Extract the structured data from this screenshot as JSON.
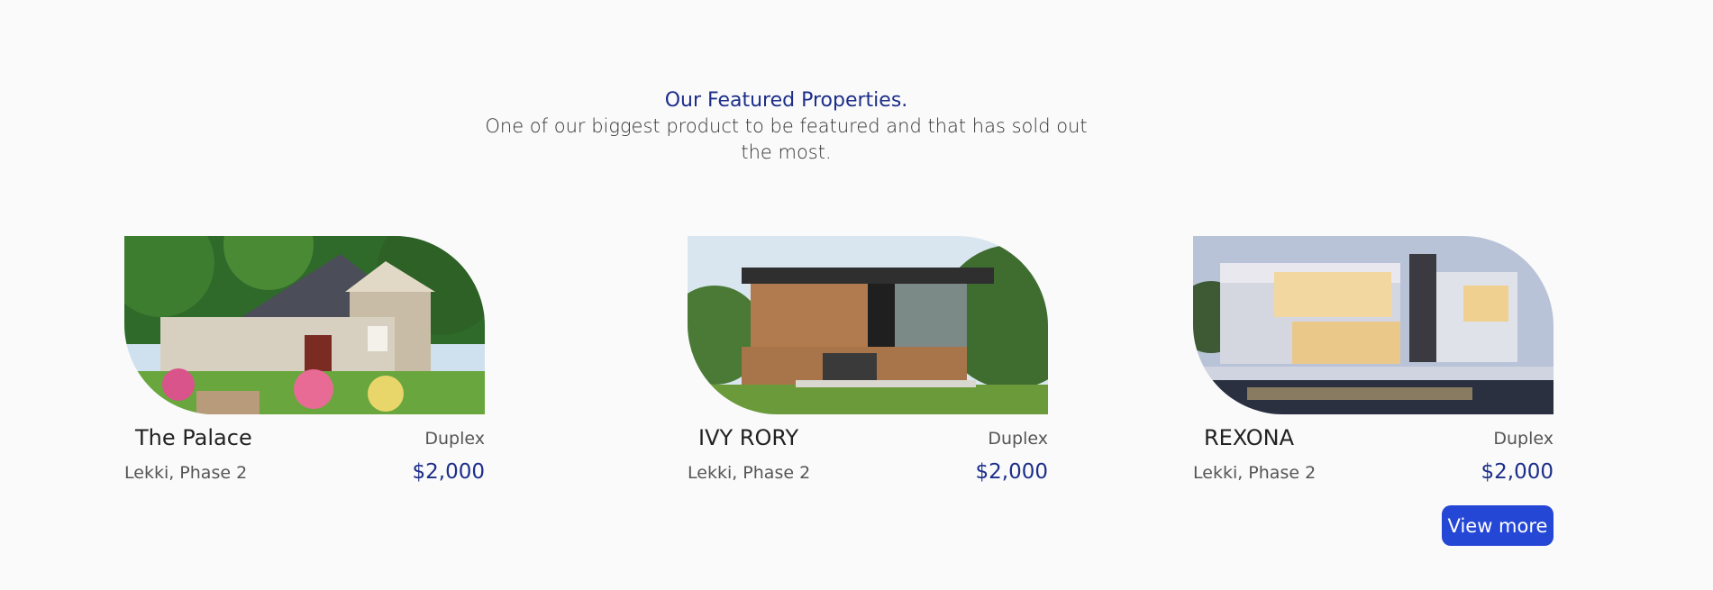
{
  "section": {
    "title": "Our Featured Properties.",
    "subtitle": "One of our biggest product to be featured and that has sold out the most."
  },
  "properties": [
    {
      "name": "The Palace",
      "type": "Duplex",
      "location": "Lekki, Phase 2",
      "price": "$2,000"
    },
    {
      "name": "IVY RORY",
      "type": "Duplex",
      "location": "Lekki, Phase 2",
      "price": "$2,000"
    },
    {
      "name": "REXONA",
      "type": "Duplex",
      "location": "Lekki, Phase 2",
      "price": "$2,000"
    }
  ],
  "actions": {
    "view_more_label": "View more"
  },
  "colors": {
    "background": "#fafafa",
    "accent_text": "#1c2e8a",
    "button": "#2547d5"
  }
}
